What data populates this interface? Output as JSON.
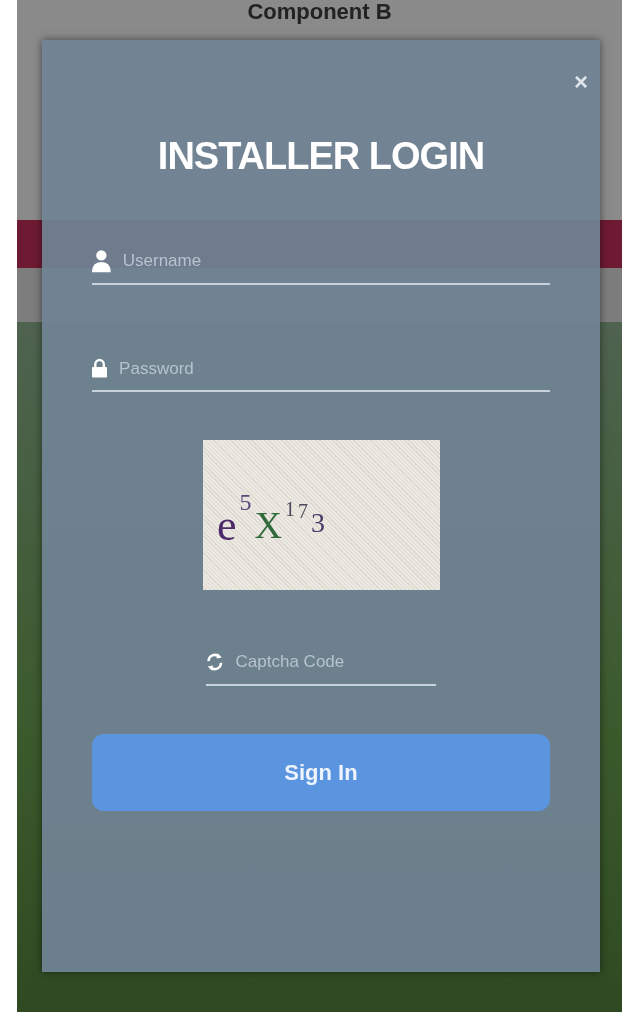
{
  "page": {
    "heading": "Component B"
  },
  "modal": {
    "title": "INSTALLER LOGIN",
    "close": "×",
    "fields": [
      {
        "kind": "user",
        "placeholder": "Username"
      },
      {
        "kind": "password",
        "placeholder": "Password"
      }
    ],
    "captcha": {
      "text": "e5X173",
      "placeholder": "Captcha Code"
    },
    "button": "Sign In"
  }
}
